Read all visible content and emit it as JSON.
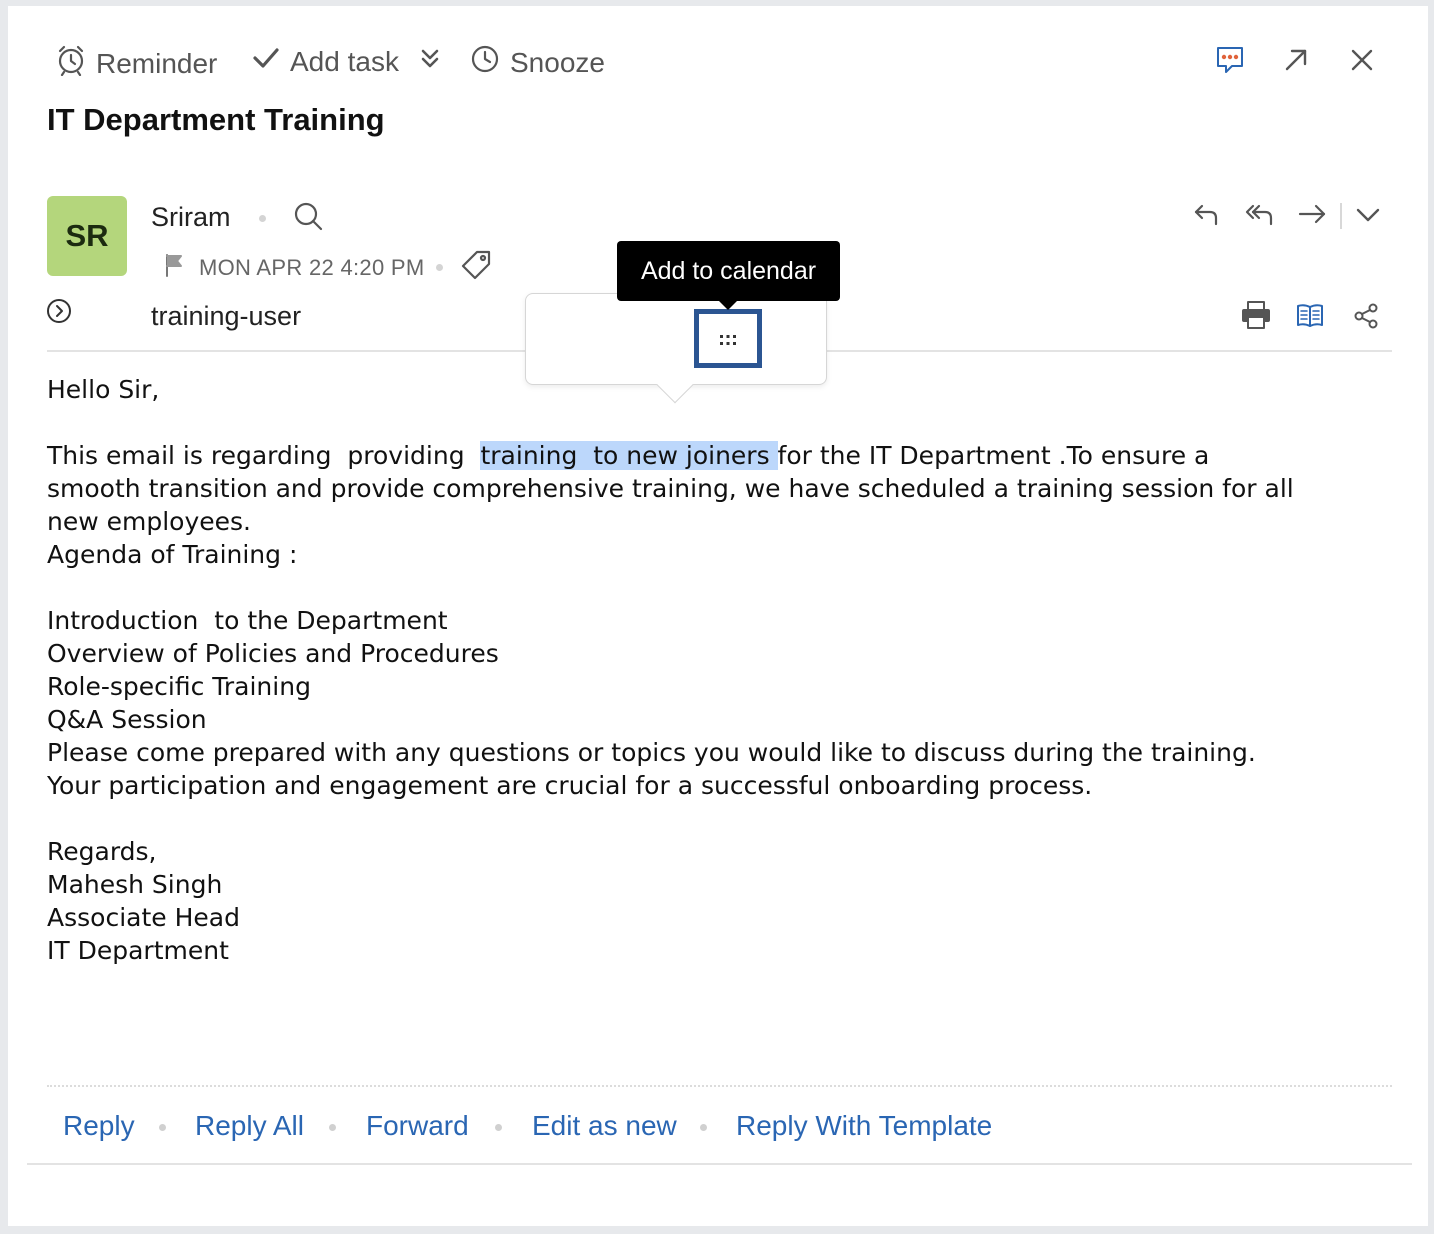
{
  "toolbar": {
    "reminder_label": "Reminder",
    "add_task_label": "Add task",
    "snooze_label": "Snooze"
  },
  "email": {
    "subject": "IT Department Training",
    "sender_initials": "SR",
    "sender_name": "Sriram",
    "date": "MON APR 22 4:20 PM",
    "recipient": "training-user"
  },
  "context_popup": {
    "tooltip": "Add to calendar",
    "actions": [
      "edit-note",
      "copy-text",
      "add-task",
      "add-to-calendar",
      "search-text"
    ],
    "selected_action": "add-to-calendar"
  },
  "body": {
    "greeting": "Hello Sir,",
    "para1_before": "This email is regarding  providing  ",
    "para1_highlight": "training  to new joiners ",
    "para1_after": "for the IT Department .To ensure a",
    "line2": "smooth transition and provide comprehensive training, we have scheduled a training session for all",
    "line3": "new employees.",
    "line4": "Agenda of Training :",
    "agenda": [
      "Introduction  to the Department",
      "Overview of Policies and Procedures",
      "Role-specific Training",
      "Q&A Session"
    ],
    "closing1": "Please come prepared with any questions or topics you would like to discuss during the training.",
    "closing2": "Your participation and engagement are crucial for a successful onboarding process.",
    "signoff": "Regards,",
    "sig_name": "Mahesh Singh",
    "sig_title": "Associate Head",
    "sig_dept": "IT Department"
  },
  "actions": {
    "reply": "Reply",
    "reply_all": "Reply All",
    "forward": "Forward",
    "edit_as_new": "Edit as new",
    "reply_with_template": "Reply With Template"
  },
  "colors": {
    "accent": "#2a66b3",
    "avatar_bg": "#b4d67c",
    "selection_highlight": "#bcd7fb",
    "selected_border": "#2b5592"
  }
}
